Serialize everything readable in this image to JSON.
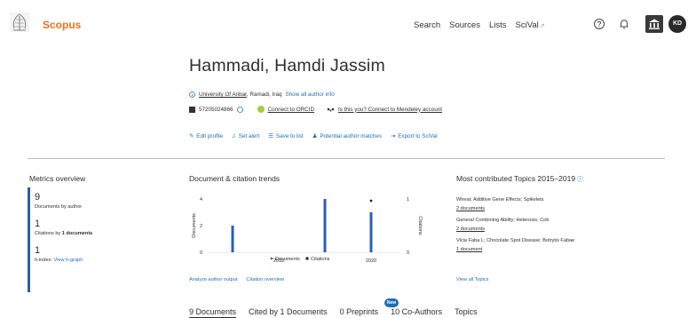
{
  "header": {
    "logo_text": "Scopus",
    "nav": [
      "Search",
      "Sources",
      "Lists",
      "SciVal"
    ],
    "scival_ext": "↗",
    "avatar_initials": "KD"
  },
  "profile": {
    "name": "Hammadi, Hamdi Jassim",
    "affiliation": "University Of Anbar",
    "location": ", Ramadi, Iraq",
    "show_all_info": "Show all author info",
    "author_id": "57205024866",
    "orcid": "Connect to ORCID",
    "mendeley": "Is this you? Connect to Mendeley account",
    "actions": [
      "Edit profile",
      "Set alert",
      "Save to list",
      "Potential author matches",
      "Export to SciVal"
    ]
  },
  "metrics": {
    "title": "Metrics overview",
    "items": [
      {
        "value": "9",
        "label": "Documents by author"
      },
      {
        "value": "1",
        "label_pre": "Citations by ",
        "label_bold": "1",
        "label_post": " documents"
      },
      {
        "value": "1",
        "label": "h-index:",
        "link": "View h-graph"
      }
    ]
  },
  "trends": {
    "title": "Document & citation trends",
    "links": [
      "Analyze author output",
      "Citation overview"
    ]
  },
  "chart_data": {
    "type": "bar",
    "x": [
      2017,
      2018,
      2019,
      2020
    ],
    "x_tick_labels": [
      "2018",
      "2020"
    ],
    "series": [
      {
        "name": "Documents",
        "type": "bar",
        "axis": "left",
        "values": [
          2,
          null,
          4,
          3
        ],
        "color": "#2e5fa8"
      },
      {
        "name": "Citations",
        "type": "point",
        "axis": "right",
        "values": [
          null,
          null,
          null,
          1
        ],
        "color": "#1e1e1e"
      }
    ],
    "ylabel": "Documents",
    "ylabel_right": "Citations",
    "ylim": [
      0,
      4
    ],
    "ylim_right": [
      0,
      1
    ],
    "y_ticks": [
      "0",
      "2",
      "4"
    ],
    "y_ticks_right": [
      "0",
      "1"
    ],
    "legend": "bottom"
  },
  "topics": {
    "title": "Most contributed Topics 2015–2019",
    "items": [
      {
        "name": "Wheat; Additive Gene Effects; Spikelets",
        "docs": "2 documents"
      },
      {
        "name": "General Combining Ability; Heterosis; Cob",
        "docs": "2 documents"
      },
      {
        "name": "Vicia Faba L; Chocolate Spot Disease; Botrytis Fabae",
        "docs": "1 document"
      }
    ],
    "view_all": "View all Topics"
  },
  "tabs": {
    "items": [
      "9 Documents",
      "Cited by 1 Documents",
      "0 Preprints",
      "10 Co-Authors",
      "Topics"
    ],
    "new_badge": "New"
  }
}
